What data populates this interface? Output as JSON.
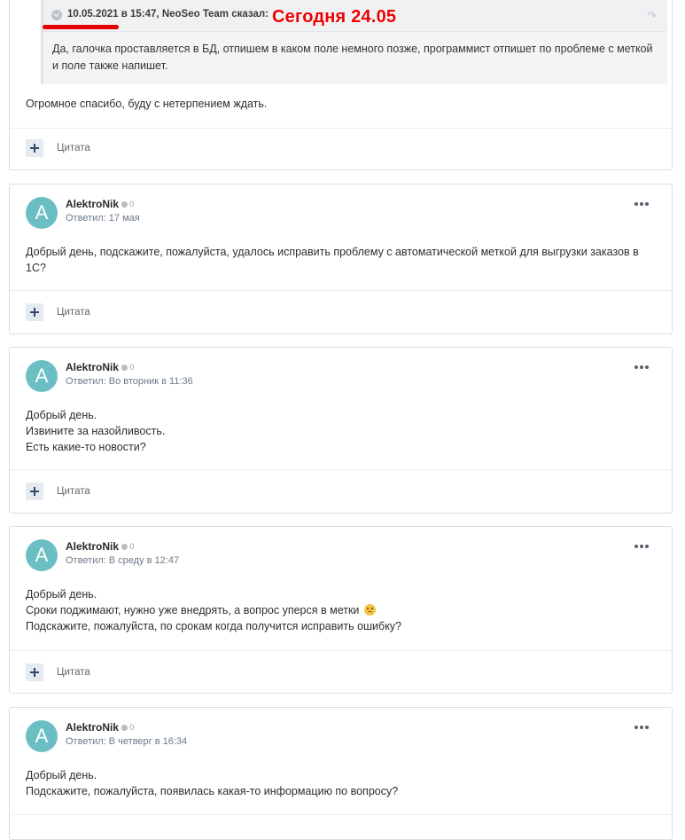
{
  "quoted": {
    "citation": "10.05.2021 в 15:47, NeoSeo Team сказал:",
    "text_line1": "Да, галочка проставляется в БД, отпишем в каком поле немного позже, программист отпишет по проблеме с меткой",
    "text_line2": "и поле также напишет.",
    "share_icon": "share-arrow-icon"
  },
  "annotation": {
    "text": "Сегодня 24.05",
    "color": "#ec0000"
  },
  "first_post": {
    "text": "Огромное спасибо, буду с нетерпением ждать.",
    "quote_label": "Цитата"
  },
  "posts": [
    {
      "avatar_letter": "A",
      "author": "AlektroNik",
      "reputation": "0",
      "meta": "Ответил: 17 мая",
      "lines": [
        "Добрый день, подскажите, пожалуйста, удалось исправить проблему с автоматической меткой для выгрузки заказов в",
        "1С?"
      ],
      "quote_label": "Цитата"
    },
    {
      "avatar_letter": "A",
      "author": "AlektroNik",
      "reputation": "0",
      "meta": "Ответил: Во вторник в 11:36",
      "lines": [
        "Добрый день.",
        "Извините за назойливость.",
        "Есть какие-то новости?"
      ],
      "quote_label": "Цитата"
    },
    {
      "avatar_letter": "A",
      "author": "AlektroNik",
      "reputation": "0",
      "meta": "Ответил: В среду в 12:47",
      "lines": [
        "Добрый день.",
        "Сроки поджимают, нужно уже внедрять, а вопрос уперся в метки",
        "Подскажите, пожалуйста, по срокам когда получится исправить ошибку?"
      ],
      "emoji": "worried-face-icon",
      "quote_label": "Цитата"
    },
    {
      "avatar_letter": "A",
      "author": "AlektroNik",
      "reputation": "0",
      "meta": "Ответил: В четверг в 16:34",
      "lines": [
        "Добрый день.",
        "Подскажите, пожалуйста, появилась какая-то информацию по вопросу?"
      ]
    }
  ],
  "colors": {
    "avatar": "#6bbfc3",
    "meta": "#6d7a89",
    "quote_button": "#e5eaf1"
  }
}
